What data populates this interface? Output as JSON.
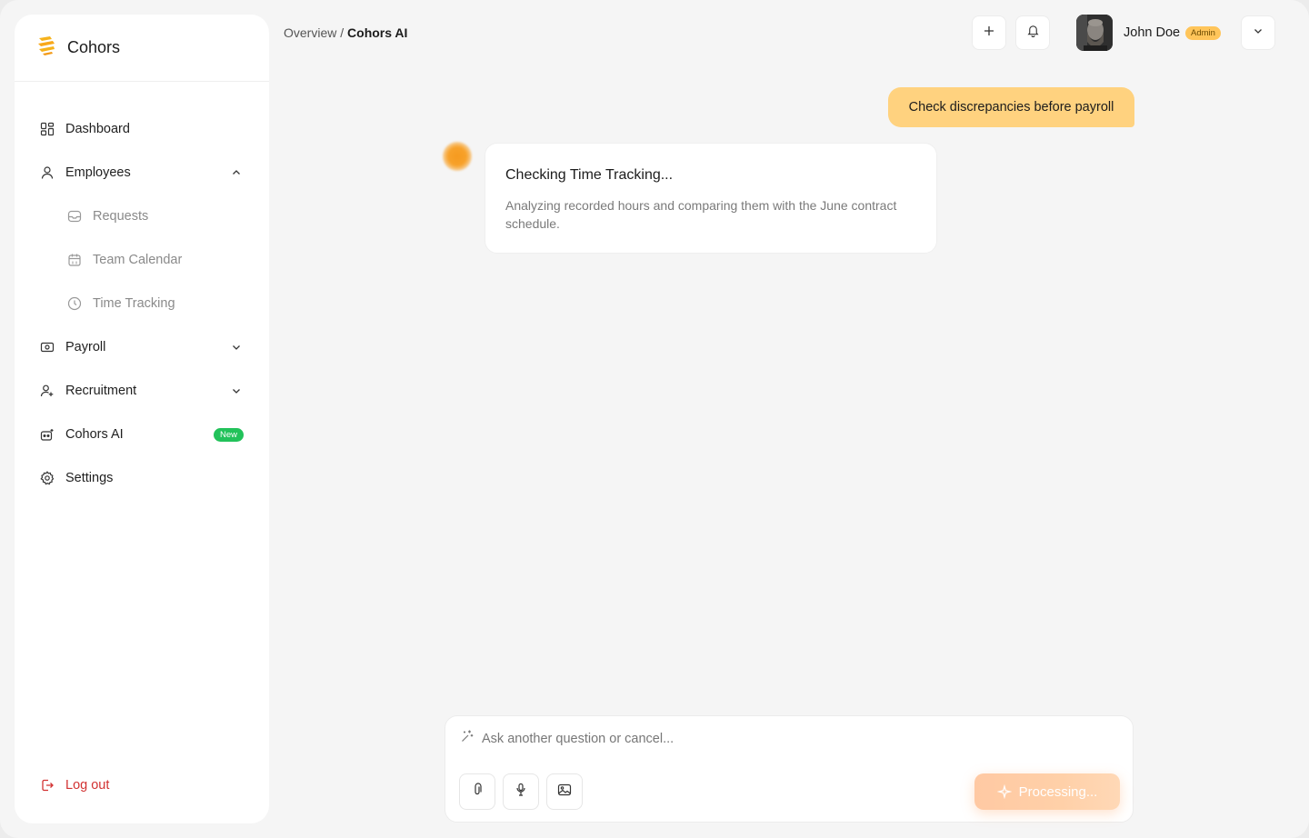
{
  "app": {
    "name": "Cohors"
  },
  "breadcrumb": {
    "parent": "Overview",
    "separator": " / ",
    "current": "Cohors AI"
  },
  "sidebar": {
    "items": [
      {
        "label": "Dashboard",
        "icon": "dashboard-icon"
      },
      {
        "label": "Employees",
        "icon": "user-icon",
        "expanded": true
      },
      {
        "label": "Requests",
        "icon": "inbox-icon",
        "sub": true
      },
      {
        "label": "Team Calendar",
        "icon": "calendar-icon",
        "sub": true
      },
      {
        "label": "Time Tracking",
        "icon": "clock-icon",
        "sub": true
      },
      {
        "label": "Payroll",
        "icon": "money-icon",
        "expanded": false
      },
      {
        "label": "Recruitment",
        "icon": "user-plus-icon",
        "expanded": false
      },
      {
        "label": "Cohors AI",
        "icon": "ai-bot-icon",
        "badge": "New"
      },
      {
        "label": "Settings",
        "icon": "gear-icon"
      }
    ],
    "logout": "Log out"
  },
  "user": {
    "name": "John Doe",
    "role": "Admin"
  },
  "chat": {
    "user_message": "Check discrepancies before payroll",
    "ai_title": "Checking Time Tracking...",
    "ai_body": "Analyzing recorded hours and comparing them with the June contract schedule."
  },
  "composer": {
    "placeholder": "Ask another question or cancel...",
    "submit_label": "Processing..."
  },
  "colors": {
    "accent": "#ffd27f",
    "badge_new": "#22c25a",
    "logout": "#d23232",
    "role_badge": "#ffc55a",
    "processing": "#ffc9a3"
  }
}
